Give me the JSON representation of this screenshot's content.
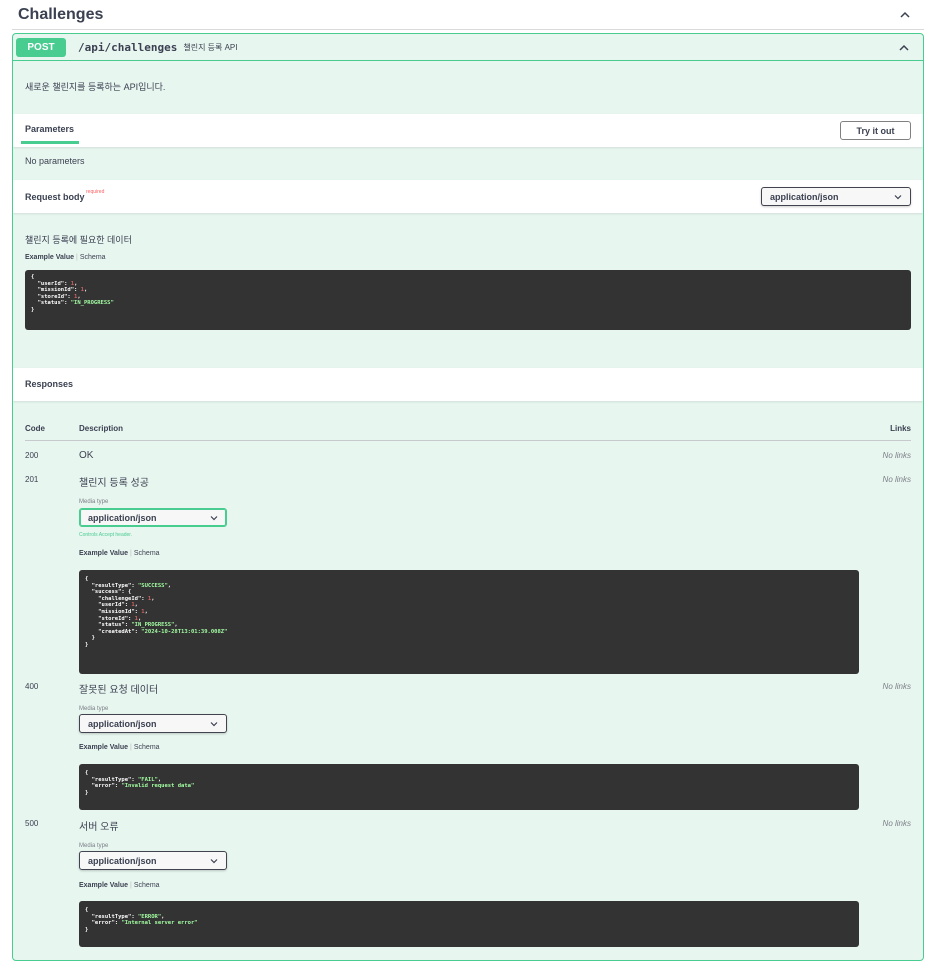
{
  "section": {
    "title": "Challenges"
  },
  "op": {
    "method": "POST",
    "path": "/api/challenges",
    "summary": "챌린지 등록 API",
    "description": "새로운 챌린지를 등록하는 API입니다."
  },
  "parameters": {
    "tab_label": "Parameters",
    "try_label": "Try it out",
    "none_text": "No parameters"
  },
  "request_body": {
    "label": "Request body",
    "required": "required",
    "content_type": "application/json",
    "description": "챌린지 등록에 필요한 데이터",
    "example_tab": "Example Value",
    "schema_tab": "Schema"
  },
  "responses": {
    "label": "Responses",
    "col_code": "Code",
    "col_description": "Description",
    "col_links": "Links",
    "rows": [
      {
        "code": "200",
        "description": "OK",
        "links": "No links"
      },
      {
        "code": "201",
        "description": "챌린지 등록 성공",
        "links": "No links",
        "media_type_label": "Media type",
        "media_type": "application/json",
        "controls": "Controls Accept header.",
        "example_tab": "Example Value",
        "schema_tab": "Schema"
      },
      {
        "code": "400",
        "description": "잘못된 요청 데이터",
        "links": "No links",
        "media_type_label": "Media type",
        "media_type": "application/json",
        "example_tab": "Example Value",
        "schema_tab": "Schema"
      },
      {
        "code": "500",
        "description": "서버 오류",
        "links": "No links",
        "media_type_label": "Media type",
        "media_type": "application/json",
        "example_tab": "Example Value",
        "schema_tab": "Schema"
      }
    ]
  },
  "examples": {
    "request": "{\n  \"userId\": 1,\n  \"missionId\": 1,\n  \"storeId\": 1,\n  \"status\": \"IN_PROGRESS\"\n}",
    "r201": "{\n  \"resultType\": \"SUCCESS\",\n  \"success\": {\n    \"challengeId\": 1,\n    \"userId\": 1,\n    \"missionId\": 1,\n    \"storeId\": 1,\n    \"status\": \"IN_PROGRESS\",\n    \"createdAt\": \"2024-10-28T13:01:39.008Z\"\n  }\n}",
    "r400": "{\n  \"resultType\": \"FAIL\",\n  \"error\": \"Invalid request data\"\n}",
    "r500": "{\n  \"resultType\": \"ERROR\",\n  \"error\": \"Internal server error\"\n}"
  },
  "colors": {
    "post": "#49cc90",
    "post_bg": "#e8f6f0",
    "code_bg": "#333333",
    "json_string": "#a2fca2",
    "json_number": "#d36363"
  }
}
